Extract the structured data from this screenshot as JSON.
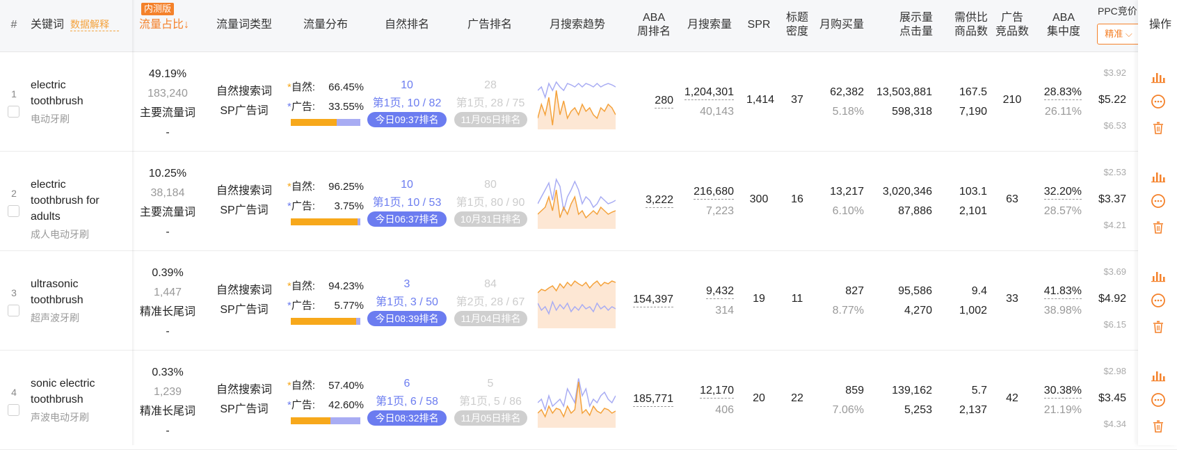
{
  "header": {
    "idx": "#",
    "keyword": "关键词",
    "data_explain": "数据解释",
    "badge": "内测版",
    "traffic_share": "流量占比",
    "sort_arrow": "↓",
    "traffic_type": "流量词类型",
    "traffic_dist": "流量分布",
    "organic_rank": "自然排名",
    "ad_rank": "广告排名",
    "trend": "月搜索趋势",
    "aba_1": "ABA",
    "aba_2": "周排名",
    "monthly_search": "月搜索量",
    "spr": "SPR",
    "title_1": "标题",
    "title_2": "密度",
    "monthly_buy": "月购买量",
    "impr_1": "展示量",
    "impr_2": "点击量",
    "supply_1": "需供比",
    "supply_2": "商品数",
    "ad_1": "广告",
    "ad_2": "竞品数",
    "concentration_1": "ABA",
    "concentration_2": "集中度",
    "ppc": "PPC竞价",
    "precise": "精准",
    "ops": "操作"
  },
  "colors": {
    "accent_orange": "#f4812a",
    "bar_orange": "#f7a81b",
    "blue": "#6b7cf0",
    "gray_pill": "#cfcfcf"
  },
  "rows": [
    {
      "idx": "1",
      "keyword": "electric toothbrush",
      "kw_lines": [
        "electric",
        "toothbrush"
      ],
      "cn": "电动牙刷",
      "share": "49.19%",
      "share_count": "183,240",
      "share_type": "主要流量词",
      "share_dash": "-",
      "type1": "自然搜索词",
      "type2": "SP广告词",
      "organic_label": "自然:",
      "organic_pct": "66.45%",
      "ad_label": "广告:",
      "ad_pct": "33.55%",
      "organic_frac": 0.6645,
      "org_rank": "10",
      "org_page": "第1页, 10 / 82",
      "org_time": "今日09:37排名",
      "ad_rank": "28",
      "ad_page": "第1页, 28 / 75",
      "ad_time": "11月05日排名",
      "aba": "280",
      "search": "1,204,301",
      "search2": "40,143",
      "spr": "1,414",
      "title_density": "37",
      "buy": "62,382",
      "buy_rate": "5.18%",
      "impr": "13,503,881",
      "click": "598,318",
      "supply": "167.5",
      "products": "7,190",
      "ad_count": "210",
      "conc": "28.83%",
      "conc2": "26.11%",
      "ppc_low": "$3.92",
      "ppc": "$5.22",
      "ppc_high": "$6.53"
    },
    {
      "idx": "2",
      "keyword": "electric toothbrush for adults",
      "kw_lines": [
        "electric",
        "toothbrush for",
        "adults"
      ],
      "cn": "成人电动牙刷",
      "share": "10.25%",
      "share_count": "38,184",
      "share_type": "主要流量词",
      "share_dash": "-",
      "type1": "自然搜索词",
      "type2": "SP广告词",
      "organic_label": "自然:",
      "organic_pct": "96.25%",
      "ad_label": "广告:",
      "ad_pct": "3.75%",
      "organic_frac": 0.9625,
      "org_rank": "10",
      "org_page": "第1页, 10 / 53",
      "org_time": "今日06:37排名",
      "ad_rank": "80",
      "ad_page": "第1页, 80 / 90",
      "ad_time": "10月31日排名",
      "aba": "3,222",
      "search": "216,680",
      "search2": "7,223",
      "spr": "300",
      "title_density": "16",
      "buy": "13,217",
      "buy_rate": "6.10%",
      "impr": "3,020,346",
      "click": "87,886",
      "supply": "103.1",
      "products": "2,101",
      "ad_count": "63",
      "conc": "32.20%",
      "conc2": "28.57%",
      "ppc_low": "$2.53",
      "ppc": "$3.37",
      "ppc_high": "$4.21"
    },
    {
      "idx": "3",
      "keyword": "ultrasonic toothbrush",
      "kw_lines": [
        "ultrasonic",
        "toothbrush"
      ],
      "cn": "超声波牙刷",
      "share": "0.39%",
      "share_count": "1,447",
      "share_type": "精准长尾词",
      "share_dash": "-",
      "type1": "自然搜索词",
      "type2": "SP广告词",
      "organic_label": "自然:",
      "organic_pct": "94.23%",
      "ad_label": "广告:",
      "ad_pct": "5.77%",
      "organic_frac": 0.9423,
      "org_rank": "3",
      "org_page": "第1页, 3 / 50",
      "org_time": "今日08:39排名",
      "ad_rank": "84",
      "ad_page": "第2页, 28 / 67",
      "ad_time": "11月04日排名",
      "aba": "154,397",
      "search": "9,432",
      "search2": "314",
      "spr": "19",
      "title_density": "11",
      "buy": "827",
      "buy_rate": "8.77%",
      "impr": "95,586",
      "click": "4,270",
      "supply": "9.4",
      "products": "1,002",
      "ad_count": "33",
      "conc": "41.83%",
      "conc2": "38.98%",
      "ppc_low": "$3.69",
      "ppc": "$4.92",
      "ppc_high": "$6.15"
    },
    {
      "idx": "4",
      "keyword": "sonic electric toothbrush",
      "kw_lines": [
        "sonic electric",
        "toothbrush"
      ],
      "cn": "声波电动牙刷",
      "share": "0.33%",
      "share_count": "1,239",
      "share_type": "精准长尾词",
      "share_dash": "-",
      "type1": "自然搜索词",
      "type2": "SP广告词",
      "organic_label": "自然:",
      "organic_pct": "57.40%",
      "ad_label": "广告:",
      "ad_pct": "42.60%",
      "organic_frac": 0.574,
      "org_rank": "6",
      "org_page": "第1页, 6 / 58",
      "org_time": "今日08:32排名",
      "ad_rank": "5",
      "ad_page": "第1页, 5 / 86",
      "ad_time": "11月05日排名",
      "aba": "185,771",
      "search": "12,170",
      "search2": "406",
      "spr": "20",
      "title_density": "22",
      "buy": "859",
      "buy_rate": "7.06%",
      "impr": "139,162",
      "click": "5,253",
      "supply": "5.7",
      "products": "2,137",
      "ad_count": "42",
      "conc": "30.38%",
      "conc2": "21.19%",
      "ppc_low": "$2.98",
      "ppc": "$3.45",
      "ppc_high": "$4.34"
    }
  ],
  "icons": [
    "bar-chart-icon",
    "more-icon",
    "trash-icon",
    "sparkline"
  ]
}
